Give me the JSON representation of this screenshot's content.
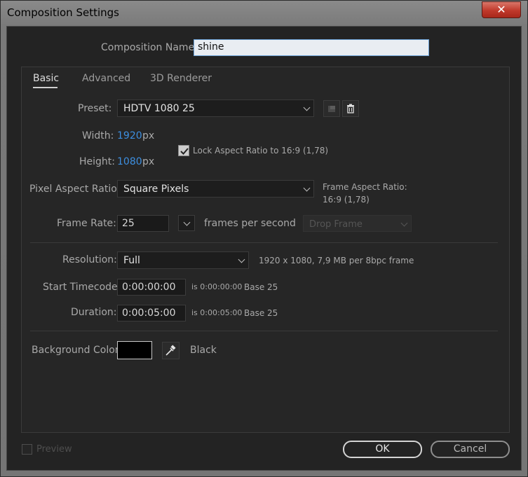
{
  "window": {
    "title": "Composition Settings",
    "close_glyph": "✕"
  },
  "comp_name": {
    "label": "Composition Name:",
    "value": "shine"
  },
  "tabs": [
    {
      "label": "Basic"
    },
    {
      "label": "Advanced"
    },
    {
      "label": "3D Renderer"
    }
  ],
  "preset": {
    "label": "Preset:",
    "value": "HDTV 1080 25"
  },
  "width": {
    "label": "Width:",
    "value": "1920",
    "unit": "px"
  },
  "height": {
    "label": "Height:",
    "value": "1080",
    "unit": "px"
  },
  "lock_aspect": {
    "label": "Lock Aspect Ratio to 16:9 (1,78)",
    "checked": true
  },
  "pixel_aspect": {
    "label": "Pixel Aspect Ratio:",
    "value": "Square Pixels"
  },
  "frame_aspect": {
    "label": "Frame Aspect Ratio:",
    "value": "16:9 (1,78)"
  },
  "frame_rate": {
    "label": "Frame Rate:",
    "value": "25",
    "unit": "frames per second",
    "drop_frame": "Drop Frame"
  },
  "resolution": {
    "label": "Resolution:",
    "value": "Full",
    "info": "1920 x 1080, 7,9 MB per 8bpc frame"
  },
  "start_timecode": {
    "label": "Start Timecode:",
    "value": "0:00:00:00",
    "is_text": "is 0:00:00:00",
    "base": "Base 25"
  },
  "duration": {
    "label": "Duration:",
    "value": "0:00:05:00",
    "is_text": "is 0:00:05:00",
    "base": "Base 25"
  },
  "background": {
    "label": "Background Color:",
    "color_name": "Black",
    "swatch_color": "#000000"
  },
  "footer": {
    "preview_label": "Preview",
    "ok_label": "OK",
    "cancel_label": "Cancel"
  },
  "colors": {
    "accent_value": "#3d8fe0",
    "dialog_bg": "#232323",
    "close_red": "#c0392b"
  },
  "icons": {
    "preset_save": "save-preset-icon",
    "preset_delete": "trash-icon",
    "eyedropper": "eyedropper-icon",
    "lock_check": "checkmark-icon"
  }
}
